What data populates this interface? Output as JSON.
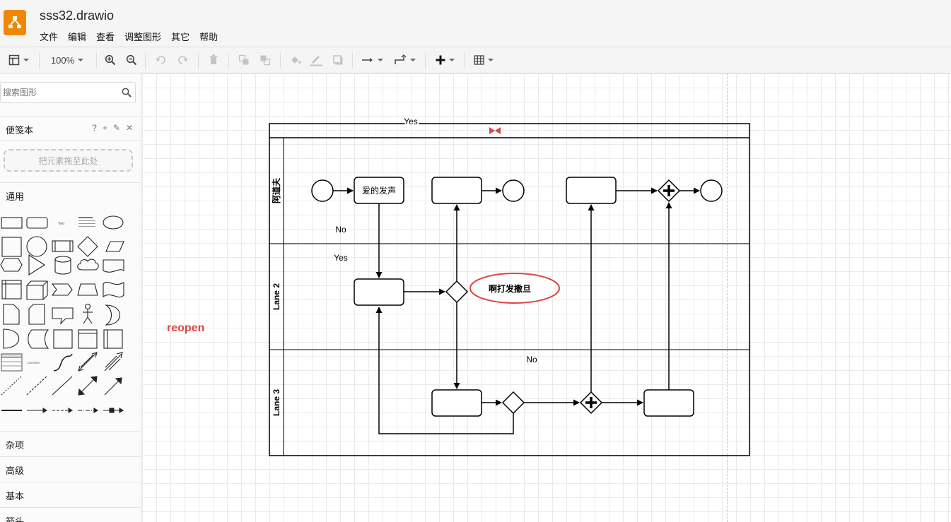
{
  "app": {
    "file_title": "sss32.drawio",
    "menu": [
      "文件",
      "编辑",
      "查看",
      "调整图形",
      "其它",
      "帮助"
    ]
  },
  "toolbar": {
    "zoom": "100%"
  },
  "sidebar": {
    "search_placeholder": "搜索图形",
    "scratchpad_label": "便笺本",
    "scratchpad_actions": [
      "?",
      "+",
      "✎",
      "✕"
    ],
    "drop_zone_text": "把元素拖至此处",
    "general_label": "通用",
    "text_shape": "Text",
    "list_item_shape": "List Item",
    "sections": [
      "杂项",
      "高级",
      "基本",
      "箭头"
    ]
  },
  "diagram": {
    "top_label": "Yes",
    "lanes": [
      "阿道夫",
      "Lane 2",
      "Lane 3"
    ],
    "task_label": "爱的发声",
    "ellipse_label": "啊打发撒旦",
    "label_no_1": "No",
    "label_yes_2": "Yes",
    "label_no_3": "No",
    "free_text": "reopen",
    "accent_color": "#e04343"
  }
}
